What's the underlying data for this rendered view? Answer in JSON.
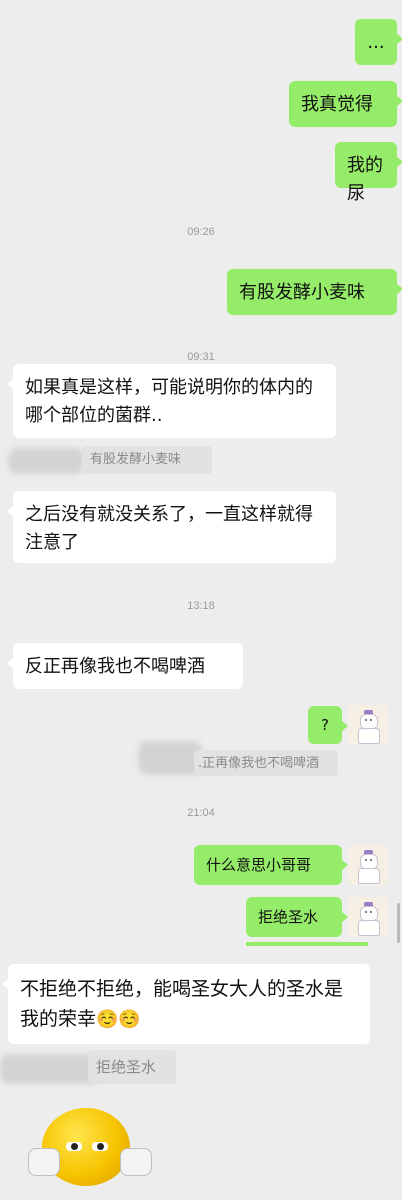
{
  "messages": {
    "m1": "...",
    "m2": "我真觉得",
    "m3": "我的尿",
    "m4": "有股发酵小麦味",
    "m5": "如果真是这样，可能说明你的体内的哪个部位的菌群..",
    "m6": "之后没有就没关系了，一直这样就得注意了",
    "m7": "反正再像我也不喝啤酒",
    "m8": "?",
    "m9": "什么意思小哥哥",
    "m10": "拒绝圣水",
    "m11": "不拒绝不拒绝，能喝圣女大人的圣水是我的荣幸"
  },
  "emojis": {
    "relieved": "☺️☺️"
  },
  "quotes": {
    "q1": "有股发酵小麦味",
    "q2": ".正再像我也不喝啤酒",
    "q3": "拒绝圣水"
  },
  "timestamps": {
    "t1": "09:26",
    "t2": "09:31",
    "t3": "13:18",
    "t4": "21:04"
  },
  "colors": {
    "my_bubble": "#95ec69",
    "other_bubble": "#ffffff",
    "background": "#ededed"
  },
  "icons": {
    "avatar": "avatar-girl",
    "sticker": "yellow-face-sticker"
  }
}
